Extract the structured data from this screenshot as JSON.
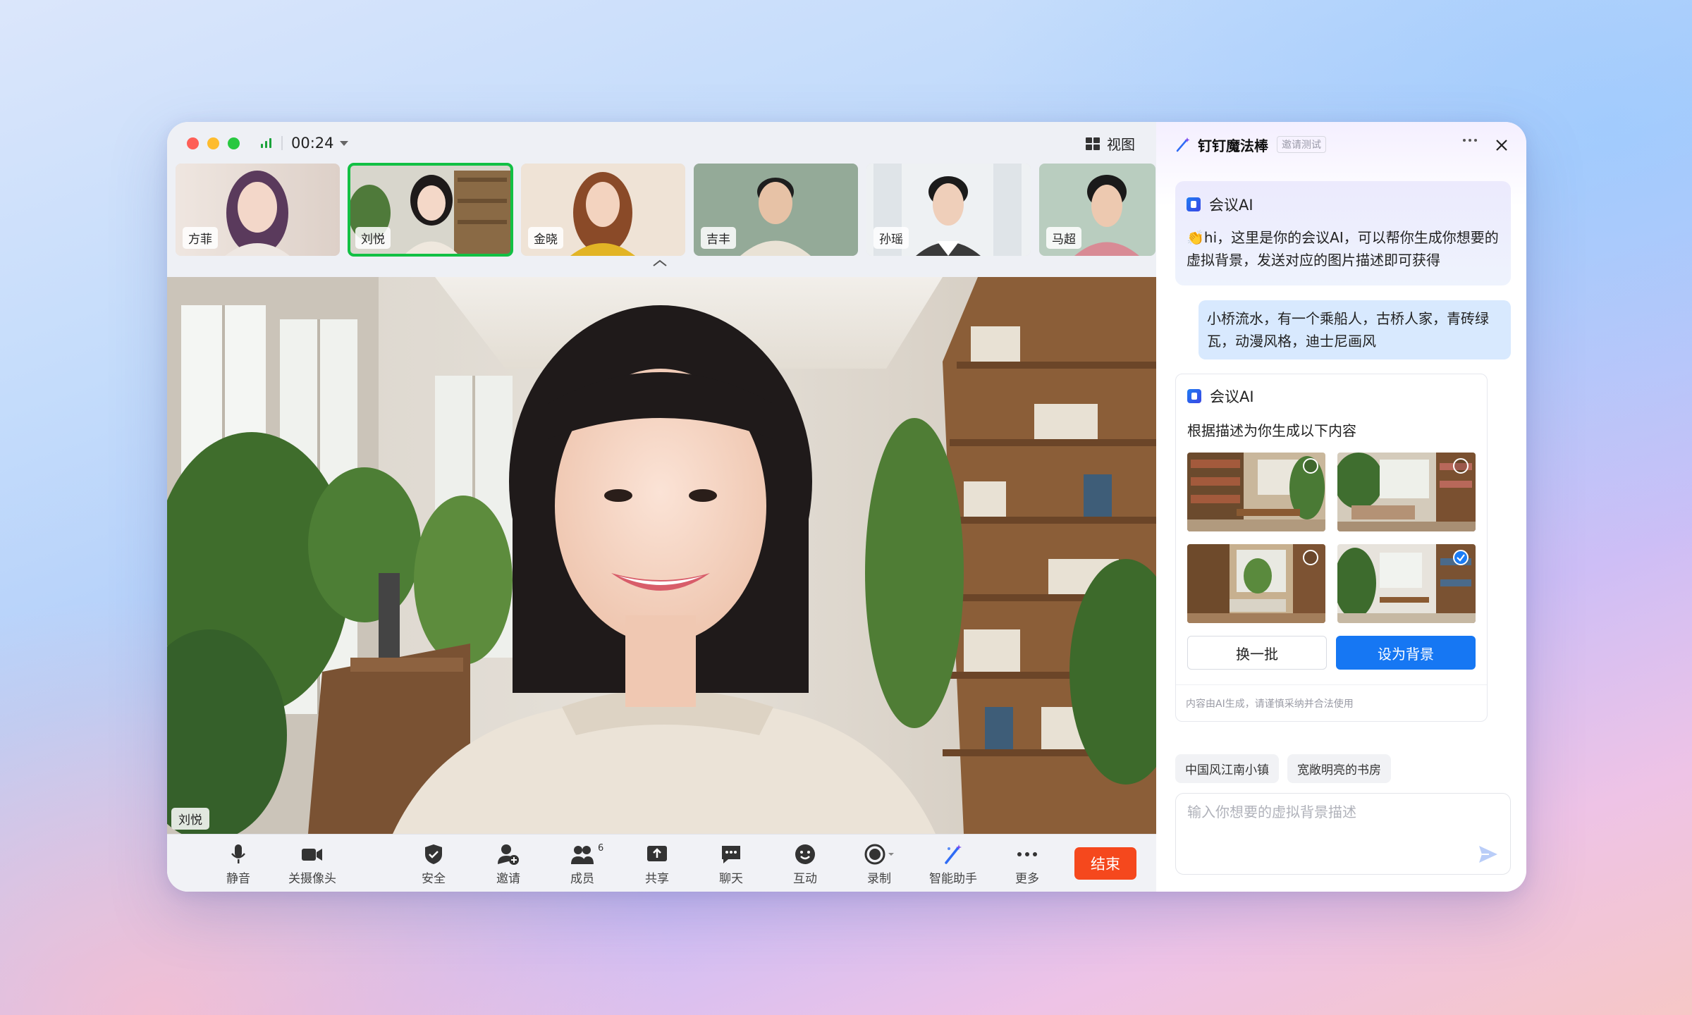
{
  "meeting": {
    "timer": "00:24",
    "view_label": "视图",
    "participants": [
      {
        "name": "方菲",
        "active": false
      },
      {
        "name": "刘悦",
        "active": true
      },
      {
        "name": "金晓",
        "active": false
      },
      {
        "name": "吉丰",
        "active": false
      },
      {
        "name": "孙瑶",
        "active": false
      },
      {
        "name": "马超",
        "active": false
      }
    ],
    "main_speaker": "刘悦",
    "toolbar": {
      "mute": "静音",
      "camera_off": "关摄像头",
      "security": "安全",
      "invite": "邀请",
      "members": "成员",
      "members_count": "6",
      "share": "共享",
      "chat": "聊天",
      "interact": "互动",
      "record": "录制",
      "assistant": "智能助手",
      "more": "更多",
      "end": "结束"
    }
  },
  "panel": {
    "title": "钉钉魔法棒",
    "tag": "邀请测试",
    "ai_name": "会议AI",
    "greeting": "👏hi，这里是你的会议AI，可以帮你生成你想要的虚拟背景，发送对应的图片描述即可获得",
    "user_message": "小桥流水，有一个乘船人，古桥人家，青砖绿瓦，动漫风格，迪士尼画风",
    "result_ai_name": "会议AI",
    "result_subtitle": "根据描述为你生成以下内容",
    "selected_image": 4,
    "refresh_button": "换一批",
    "set_bg_button": "设为背景",
    "disclaimer": "内容由AI生成，请谨慎采纳并合法使用",
    "suggestions": [
      "中国风江南小镇",
      "宽敞明亮的书房"
    ],
    "input_placeholder": "输入你想要的虚拟背景描述",
    "input_value": ""
  }
}
